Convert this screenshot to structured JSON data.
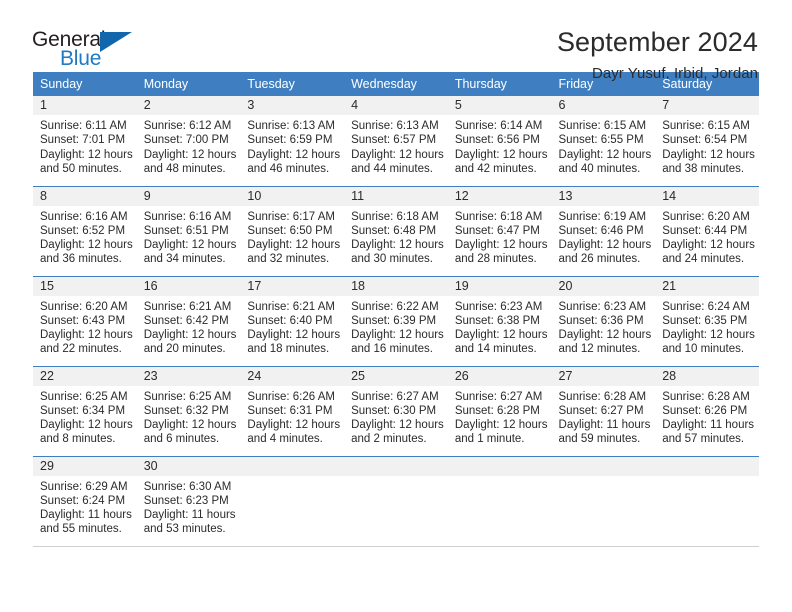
{
  "brand": {
    "name_top": "General",
    "name_bottom": "Blue",
    "triangle_color": "#1266ab",
    "blue_color": "#1f7ac1"
  },
  "header": {
    "title": "September 2024",
    "location": "Dayr Yusuf, Irbid, Jordan"
  },
  "theme": {
    "header_row_bg": "#3f7fc1",
    "daynum_bg": "#f1f1f1",
    "row_divider": "#3f7fc1",
    "text": "#2b2b2b"
  },
  "weekday_headers": [
    "Sunday",
    "Monday",
    "Tuesday",
    "Wednesday",
    "Thursday",
    "Friday",
    "Saturday"
  ],
  "weeks": [
    [
      {
        "day": "1",
        "sunrise": "Sunrise: 6:11 AM",
        "sunset": "Sunset: 7:01 PM",
        "daylight1": "Daylight: 12 hours",
        "daylight2": "and 50 minutes."
      },
      {
        "day": "2",
        "sunrise": "Sunrise: 6:12 AM",
        "sunset": "Sunset: 7:00 PM",
        "daylight1": "Daylight: 12 hours",
        "daylight2": "and 48 minutes."
      },
      {
        "day": "3",
        "sunrise": "Sunrise: 6:13 AM",
        "sunset": "Sunset: 6:59 PM",
        "daylight1": "Daylight: 12 hours",
        "daylight2": "and 46 minutes."
      },
      {
        "day": "4",
        "sunrise": "Sunrise: 6:13 AM",
        "sunset": "Sunset: 6:57 PM",
        "daylight1": "Daylight: 12 hours",
        "daylight2": "and 44 minutes."
      },
      {
        "day": "5",
        "sunrise": "Sunrise: 6:14 AM",
        "sunset": "Sunset: 6:56 PM",
        "daylight1": "Daylight: 12 hours",
        "daylight2": "and 42 minutes."
      },
      {
        "day": "6",
        "sunrise": "Sunrise: 6:15 AM",
        "sunset": "Sunset: 6:55 PM",
        "daylight1": "Daylight: 12 hours",
        "daylight2": "and 40 minutes."
      },
      {
        "day": "7",
        "sunrise": "Sunrise: 6:15 AM",
        "sunset": "Sunset: 6:54 PM",
        "daylight1": "Daylight: 12 hours",
        "daylight2": "and 38 minutes."
      }
    ],
    [
      {
        "day": "8",
        "sunrise": "Sunrise: 6:16 AM",
        "sunset": "Sunset: 6:52 PM",
        "daylight1": "Daylight: 12 hours",
        "daylight2": "and 36 minutes."
      },
      {
        "day": "9",
        "sunrise": "Sunrise: 6:16 AM",
        "sunset": "Sunset: 6:51 PM",
        "daylight1": "Daylight: 12 hours",
        "daylight2": "and 34 minutes."
      },
      {
        "day": "10",
        "sunrise": "Sunrise: 6:17 AM",
        "sunset": "Sunset: 6:50 PM",
        "daylight1": "Daylight: 12 hours",
        "daylight2": "and 32 minutes."
      },
      {
        "day": "11",
        "sunrise": "Sunrise: 6:18 AM",
        "sunset": "Sunset: 6:48 PM",
        "daylight1": "Daylight: 12 hours",
        "daylight2": "and 30 minutes."
      },
      {
        "day": "12",
        "sunrise": "Sunrise: 6:18 AM",
        "sunset": "Sunset: 6:47 PM",
        "daylight1": "Daylight: 12 hours",
        "daylight2": "and 28 minutes."
      },
      {
        "day": "13",
        "sunrise": "Sunrise: 6:19 AM",
        "sunset": "Sunset: 6:46 PM",
        "daylight1": "Daylight: 12 hours",
        "daylight2": "and 26 minutes."
      },
      {
        "day": "14",
        "sunrise": "Sunrise: 6:20 AM",
        "sunset": "Sunset: 6:44 PM",
        "daylight1": "Daylight: 12 hours",
        "daylight2": "and 24 minutes."
      }
    ],
    [
      {
        "day": "15",
        "sunrise": "Sunrise: 6:20 AM",
        "sunset": "Sunset: 6:43 PM",
        "daylight1": "Daylight: 12 hours",
        "daylight2": "and 22 minutes."
      },
      {
        "day": "16",
        "sunrise": "Sunrise: 6:21 AM",
        "sunset": "Sunset: 6:42 PM",
        "daylight1": "Daylight: 12 hours",
        "daylight2": "and 20 minutes."
      },
      {
        "day": "17",
        "sunrise": "Sunrise: 6:21 AM",
        "sunset": "Sunset: 6:40 PM",
        "daylight1": "Daylight: 12 hours",
        "daylight2": "and 18 minutes."
      },
      {
        "day": "18",
        "sunrise": "Sunrise: 6:22 AM",
        "sunset": "Sunset: 6:39 PM",
        "daylight1": "Daylight: 12 hours",
        "daylight2": "and 16 minutes."
      },
      {
        "day": "19",
        "sunrise": "Sunrise: 6:23 AM",
        "sunset": "Sunset: 6:38 PM",
        "daylight1": "Daylight: 12 hours",
        "daylight2": "and 14 minutes."
      },
      {
        "day": "20",
        "sunrise": "Sunrise: 6:23 AM",
        "sunset": "Sunset: 6:36 PM",
        "daylight1": "Daylight: 12 hours",
        "daylight2": "and 12 minutes."
      },
      {
        "day": "21",
        "sunrise": "Sunrise: 6:24 AM",
        "sunset": "Sunset: 6:35 PM",
        "daylight1": "Daylight: 12 hours",
        "daylight2": "and 10 minutes."
      }
    ],
    [
      {
        "day": "22",
        "sunrise": "Sunrise: 6:25 AM",
        "sunset": "Sunset: 6:34 PM",
        "daylight1": "Daylight: 12 hours",
        "daylight2": "and 8 minutes."
      },
      {
        "day": "23",
        "sunrise": "Sunrise: 6:25 AM",
        "sunset": "Sunset: 6:32 PM",
        "daylight1": "Daylight: 12 hours",
        "daylight2": "and 6 minutes."
      },
      {
        "day": "24",
        "sunrise": "Sunrise: 6:26 AM",
        "sunset": "Sunset: 6:31 PM",
        "daylight1": "Daylight: 12 hours",
        "daylight2": "and 4 minutes."
      },
      {
        "day": "25",
        "sunrise": "Sunrise: 6:27 AM",
        "sunset": "Sunset: 6:30 PM",
        "daylight1": "Daylight: 12 hours",
        "daylight2": "and 2 minutes."
      },
      {
        "day": "26",
        "sunrise": "Sunrise: 6:27 AM",
        "sunset": "Sunset: 6:28 PM",
        "daylight1": "Daylight: 12 hours",
        "daylight2": "and 1 minute."
      },
      {
        "day": "27",
        "sunrise": "Sunrise: 6:28 AM",
        "sunset": "Sunset: 6:27 PM",
        "daylight1": "Daylight: 11 hours",
        "daylight2": "and 59 minutes."
      },
      {
        "day": "28",
        "sunrise": "Sunrise: 6:28 AM",
        "sunset": "Sunset: 6:26 PM",
        "daylight1": "Daylight: 11 hours",
        "daylight2": "and 57 minutes."
      }
    ],
    [
      {
        "day": "29",
        "sunrise": "Sunrise: 6:29 AM",
        "sunset": "Sunset: 6:24 PM",
        "daylight1": "Daylight: 11 hours",
        "daylight2": "and 55 minutes."
      },
      {
        "day": "30",
        "sunrise": "Sunrise: 6:30 AM",
        "sunset": "Sunset: 6:23 PM",
        "daylight1": "Daylight: 11 hours",
        "daylight2": "and 53 minutes."
      },
      {
        "day": "",
        "sunrise": "",
        "sunset": "",
        "daylight1": "",
        "daylight2": ""
      },
      {
        "day": "",
        "sunrise": "",
        "sunset": "",
        "daylight1": "",
        "daylight2": ""
      },
      {
        "day": "",
        "sunrise": "",
        "sunset": "",
        "daylight1": "",
        "daylight2": ""
      },
      {
        "day": "",
        "sunrise": "",
        "sunset": "",
        "daylight1": "",
        "daylight2": ""
      },
      {
        "day": "",
        "sunrise": "",
        "sunset": "",
        "daylight1": "",
        "daylight2": ""
      }
    ]
  ]
}
